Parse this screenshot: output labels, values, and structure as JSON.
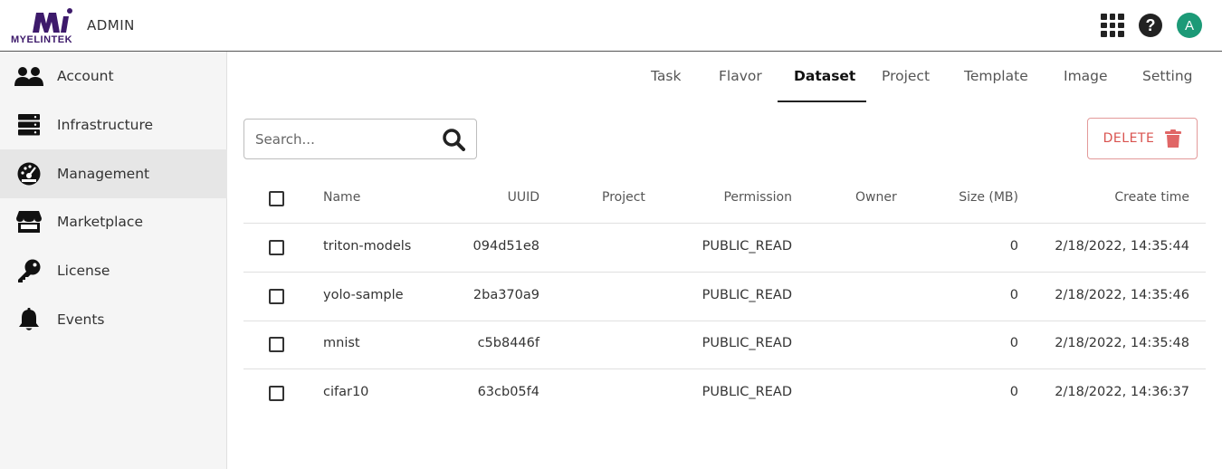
{
  "header": {
    "brand": "MYELINTEK",
    "role": "ADMIN",
    "avatar_letter": "A",
    "icons": [
      "apps-grid-icon",
      "help-icon"
    ],
    "logo_color": "#3d1a6b",
    "avatar_color": "#1c9a77"
  },
  "sidebar": {
    "items": [
      {
        "label": "Account",
        "icon": "users-icon"
      },
      {
        "label": "Infrastructure",
        "icon": "server-icon"
      },
      {
        "label": "Management",
        "icon": "gauge-icon",
        "active": true
      },
      {
        "label": "Marketplace",
        "icon": "store-icon"
      },
      {
        "label": "License",
        "icon": "key-icon"
      },
      {
        "label": "Events",
        "icon": "bell-icon"
      }
    ]
  },
  "tabs": {
    "items": [
      "Task",
      "Flavor",
      "Dataset",
      "Project",
      "Template",
      "Image",
      "Setting"
    ],
    "active": "Dataset"
  },
  "search": {
    "placeholder": "Search..."
  },
  "toolbar": {
    "delete_label": "DELETE",
    "delete_color": "#d9534f"
  },
  "table": {
    "columns": [
      "Name",
      "UUID",
      "Project",
      "Permission",
      "Owner",
      "Size (MB)",
      "Create time"
    ],
    "rows": [
      {
        "name": "triton-models",
        "uuid": "094d51e8",
        "project": "",
        "permission": "PUBLIC_READ",
        "owner": "",
        "size": "0",
        "created": "2/18/2022, 14:35:44"
      },
      {
        "name": "yolo-sample",
        "uuid": "2ba370a9",
        "project": "",
        "permission": "PUBLIC_READ",
        "owner": "",
        "size": "0",
        "created": "2/18/2022, 14:35:46"
      },
      {
        "name": "mnist",
        "uuid": "c5b8446f",
        "project": "",
        "permission": "PUBLIC_READ",
        "owner": "",
        "size": "0",
        "created": "2/18/2022, 14:35:48"
      },
      {
        "name": "cifar10",
        "uuid": "63cb05f4",
        "project": "",
        "permission": "PUBLIC_READ",
        "owner": "",
        "size": "0",
        "created": "2/18/2022, 14:36:37"
      }
    ]
  }
}
